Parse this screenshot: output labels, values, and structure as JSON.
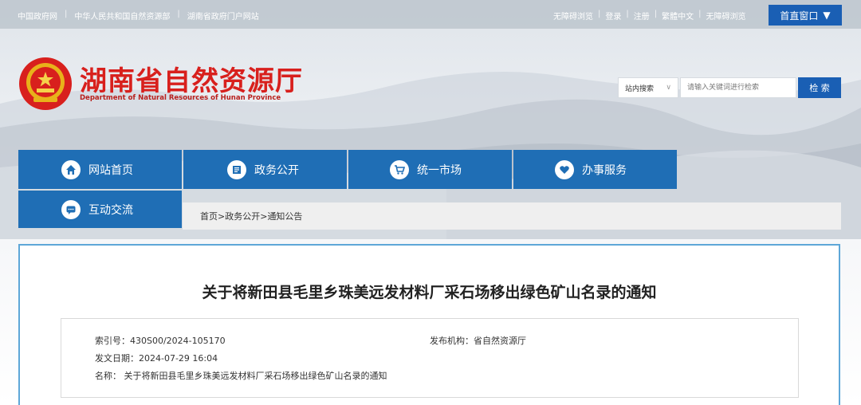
{
  "topbar": {
    "links": [
      "中国政府网",
      "中华人民共和国自然资源部",
      "湖南省政府门户网站"
    ],
    "right_links": [
      "无障碍浏览",
      "登录",
      "注册",
      "繁體中文",
      "无障碍浏览"
    ],
    "accessible_window": "首直窗口"
  },
  "header": {
    "title": "湖南省自然资源厅",
    "subtitle": "Department of Natural Resources of Hunan Province"
  },
  "search": {
    "scope": "站内搜索",
    "placeholder": "请输入关键词进行检索",
    "button": "检 索"
  },
  "nav": {
    "items": [
      {
        "label": "网站首页",
        "icon": "home-icon"
      },
      {
        "label": "政务公开",
        "icon": "document-icon"
      },
      {
        "label": "统一市场",
        "icon": "cart-icon"
      },
      {
        "label": "办事服务",
        "icon": "heart-icon"
      },
      {
        "label": "互动交流",
        "icon": "chat-icon"
      }
    ]
  },
  "breadcrumb": {
    "items": [
      "首页",
      "政务公开",
      "通知公告"
    ],
    "separator": ">"
  },
  "article": {
    "title": "关于将新田县毛里乡珠美远发材料厂采石场移出绿色矿山名录的通知",
    "index_no": "索引号：430S00/2024-105170",
    "publisher": "发布机构：省自然资源厅",
    "date": "发文日期：2024-07-29 16:04",
    "name": "名称： 关于将新田县毛里乡珠美远发材料厂采石场移出绿色矿山名录的通知"
  },
  "colors": {
    "brand_red": "#d8201d",
    "nav_blue": "#1f6eb5",
    "button_blue": "#1a5fb4",
    "panel_border": "#5ea7d8"
  }
}
